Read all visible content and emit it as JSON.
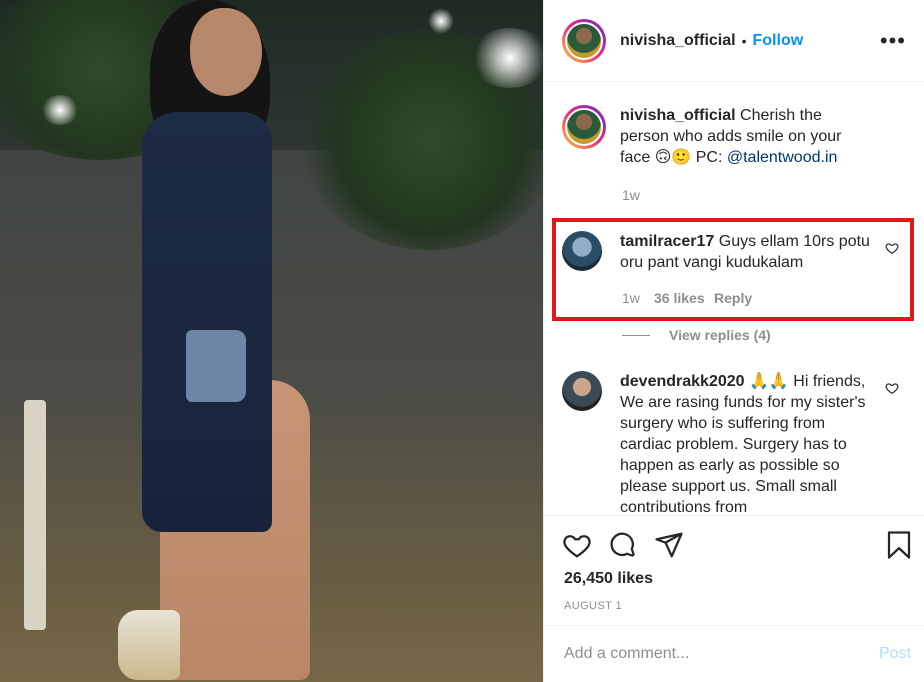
{
  "header": {
    "username": "nivisha_official",
    "separator": "•",
    "follow_label": "Follow",
    "more_label": "•••"
  },
  "caption": {
    "username": "nivisha_official",
    "text": "Cherish the person who adds smile on your face 🙃🙂 PC: ",
    "mention": "@talentwood.in",
    "time": "1w"
  },
  "comments": [
    {
      "username": "tamilracer17",
      "text": "Guys ellam 10rs potu oru pant vangi kudukalam",
      "time": "1w",
      "likes": "36 likes",
      "reply_label": "Reply",
      "view_replies": "View replies (4)"
    },
    {
      "username": "devendrakk2020",
      "text": "🙏🙏 Hi friends, We are rasing funds for my sister's surgery who is suffering from cardiac problem. Surgery has to happen as early as possible so please support us. Small small contributions from"
    }
  ],
  "actions": {
    "likes_count": "26,450 likes",
    "date": "AUGUST 1"
  },
  "add_comment": {
    "placeholder": "Add a comment...",
    "post_label": "Post"
  },
  "icons": [
    "heart-icon",
    "comment-icon",
    "share-icon",
    "bookmark-icon",
    "more-options-icon",
    "small-heart-icon"
  ],
  "colors": {
    "follow": "#0095f6",
    "highlight": "#e3161c",
    "muted": "#8e8e8e",
    "post_disabled": "#b2dffc"
  }
}
